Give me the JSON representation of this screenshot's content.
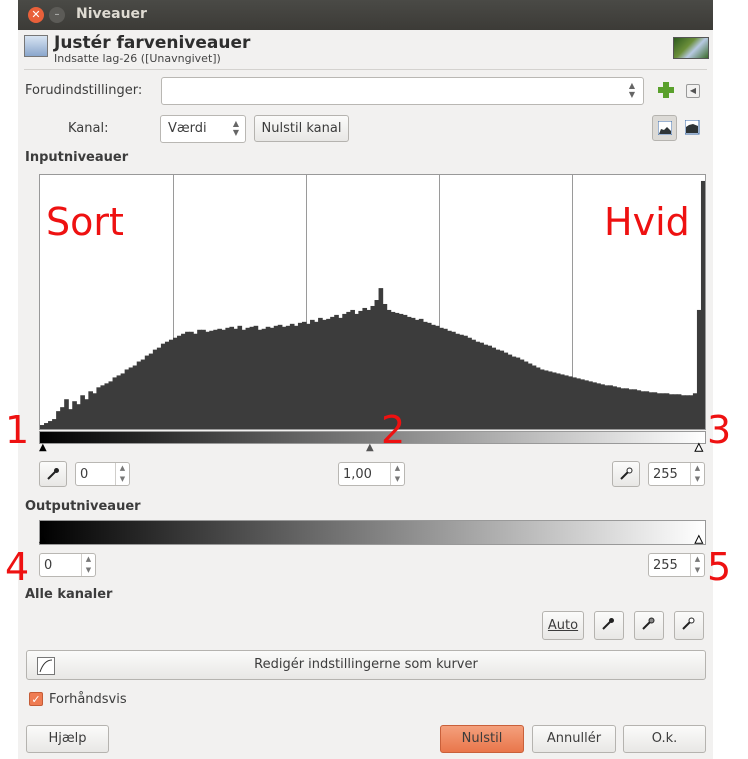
{
  "window": {
    "title": "Niveauer"
  },
  "header": {
    "title": "Justér farveniveauer",
    "subtitle": "Indsatte lag-26 ([Unavngivet])"
  },
  "presets": {
    "label": "Forudindstillinger:",
    "value": ""
  },
  "channel": {
    "label": "Kanal:",
    "value": "Værdi",
    "reset_label": "Nulstil kanal"
  },
  "input": {
    "section_label": "Inputniveauer",
    "black_value": "0",
    "gamma_value": "1,00",
    "white_value": "255"
  },
  "output": {
    "section_label": "Outputniveauer",
    "low_value": "0",
    "high_value": "255"
  },
  "all_channels": {
    "section_label": "Alle kanaler",
    "auto_label": "Auto"
  },
  "curves_button": {
    "label": "Redigér indstillingerne som kurver"
  },
  "preview": {
    "label": "Forhåndsvis",
    "checked": true
  },
  "footer": {
    "help": "Hjælp",
    "reset": "Nulstil",
    "cancel": "Annullér",
    "ok": "O.k."
  },
  "annotations": {
    "sort": "Sort",
    "hvid": "Hvid",
    "n1": "1",
    "n2": "2",
    "n3": "3",
    "n4": "4",
    "n5": "5"
  },
  "histogram": {
    "values": [
      4,
      6,
      8,
      10,
      18,
      22,
      30,
      20,
      28,
      25,
      34,
      30,
      38,
      36,
      42,
      44,
      46,
      48,
      52,
      54,
      56,
      60,
      62,
      64,
      68,
      70,
      74,
      76,
      80,
      82,
      86,
      88,
      90,
      92,
      94,
      96,
      98,
      98,
      96,
      100,
      100,
      98,
      99,
      100,
      101,
      100,
      102,
      103,
      101,
      104,
      100,
      102,
      103,
      104,
      100,
      101,
      103,
      102,
      104,
      105,
      103,
      104,
      106,
      104,
      107,
      108,
      106,
      110,
      108,
      112,
      110,
      111,
      113,
      115,
      112,
      116,
      118,
      120,
      116,
      119,
      122,
      120,
      124,
      130,
      142,
      126,
      120,
      118,
      117,
      116,
      115,
      113,
      112,
      110,
      111,
      108,
      107,
      105,
      104,
      102,
      101,
      99,
      98,
      96,
      95,
      94,
      92,
      90,
      88,
      87,
      85,
      84,
      82,
      80,
      79,
      77,
      75,
      73,
      72,
      70,
      68,
      66,
      64,
      62,
      60,
      59,
      58,
      57,
      56,
      55,
      54,
      53,
      52,
      51,
      50,
      49,
      48,
      47,
      46,
      45,
      44,
      44,
      43,
      42,
      41,
      41,
      40,
      40,
      39,
      38,
      38,
      37,
      37,
      36,
      36,
      36,
      35,
      35,
      35,
      34,
      34,
      34,
      36,
      120,
      250
    ],
    "max": 256
  },
  "colors": {
    "accent": "#e9764b",
    "annotation": "#ee1111",
    "histogram_fill": "#3c3c3c"
  }
}
